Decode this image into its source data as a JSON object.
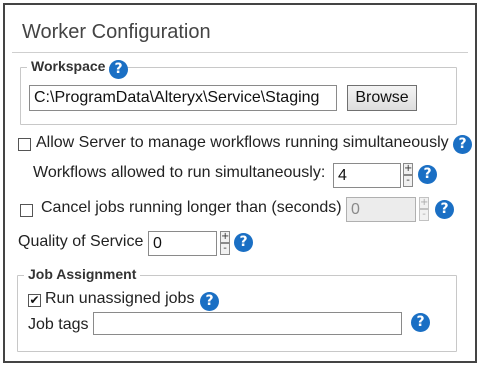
{
  "page": {
    "title": "Worker Configuration"
  },
  "workspace": {
    "legend": "Workspace",
    "path_value": "C:\\ProgramData\\Alteryx\\Service\\Staging",
    "browse_label": "Browse"
  },
  "options": {
    "allow_server_label": "Allow Server to manage workflows running simultaneously",
    "allow_server_checked": false,
    "workflows_label": "Workflows allowed to run simultaneously:",
    "workflows_value": "4",
    "cancel_jobs_label": "Cancel jobs running longer than (seconds)",
    "cancel_jobs_checked": false,
    "cancel_jobs_value": "0",
    "qos_label": "Quality of Service",
    "qos_value": "0"
  },
  "job_assignment": {
    "legend": "Job Assignment",
    "run_unassigned_label": "Run unassigned jobs",
    "run_unassigned_checked": true,
    "job_tags_label": "Job tags",
    "job_tags_value": ""
  },
  "icons": {
    "help": "help-icon",
    "help_glyph": "?",
    "check_glyph": "✔",
    "plus": "+",
    "minus": "-"
  },
  "colors": {
    "help_icon": "#1a6fc4"
  }
}
